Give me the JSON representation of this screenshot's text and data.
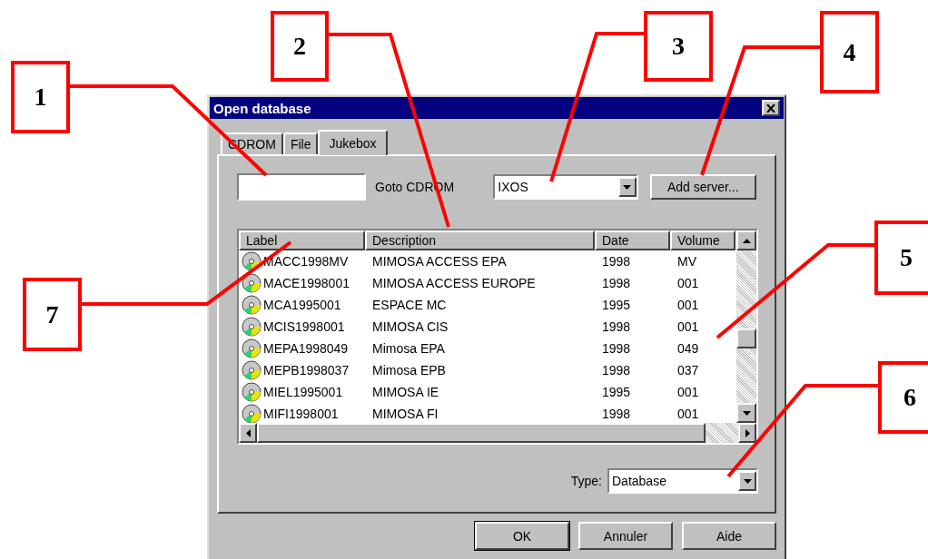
{
  "callouts": [
    {
      "number": "1"
    },
    {
      "number": "2"
    },
    {
      "number": "3"
    },
    {
      "number": "4"
    },
    {
      "number": "5"
    },
    {
      "number": "6"
    },
    {
      "number": "7"
    }
  ],
  "window": {
    "title": "Open database"
  },
  "tabs": [
    {
      "label": "CDROM",
      "selected": false
    },
    {
      "label": "File",
      "selected": false
    },
    {
      "label": "Jukebox",
      "selected": true
    }
  ],
  "goto_label": "Goto CDROM",
  "server": {
    "value": "IXOS"
  },
  "add_server_button": "Add server...",
  "table": {
    "columns": [
      "Label",
      "Description",
      "Date",
      "Volume"
    ],
    "rows": [
      [
        "MACC1998MV",
        "MIMOSA ACCESS EPA",
        "1998",
        "MV"
      ],
      [
        "MACE1998001",
        "MIMOSA ACCESS EUROPE",
        "1998",
        "001"
      ],
      [
        "MCA1995001",
        "ESPACE MC",
        "1995",
        "001"
      ],
      [
        "MCIS1998001",
        "MIMOSA CIS",
        "1998",
        "001"
      ],
      [
        "MEPA1998049",
        "Mimosa EPA",
        "1998",
        "049"
      ],
      [
        "MEPB1998037",
        "Mimosa EPB",
        "1998",
        "037"
      ],
      [
        "MIEL1995001",
        "MIMOSA IE",
        "1995",
        "001"
      ],
      [
        "MIFI1998001",
        "MIMOSA FI",
        "1998",
        "001"
      ]
    ]
  },
  "type": {
    "label": "Type:",
    "value": "Database"
  },
  "buttons": [
    "OK",
    "Annuler",
    "Aide"
  ]
}
